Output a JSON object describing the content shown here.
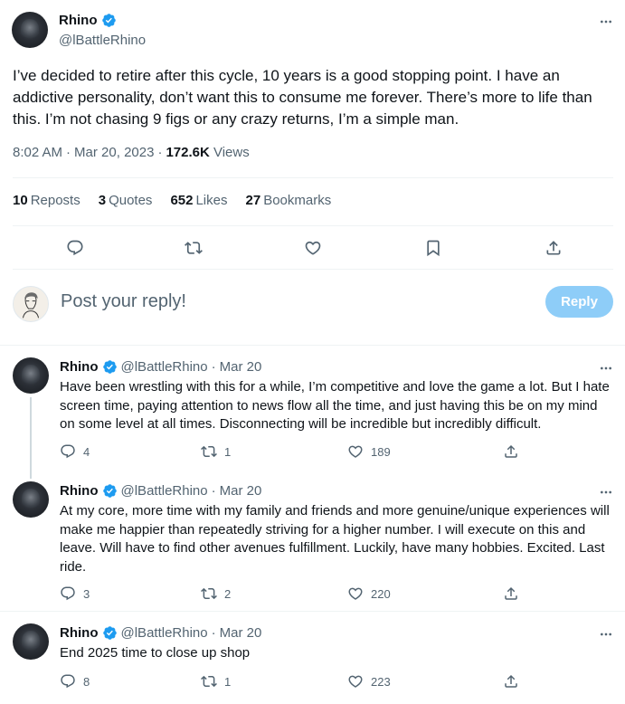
{
  "tweet": {
    "author_name": "Rhino",
    "author_handle": "@lBattleRhino",
    "text": "I’ve decided to retire after this cycle, 10 years is a good stopping point. I have an addictive personality, don’t want this to consume me forever. There’s more to life than this. I’m not chasing 9 figs or any crazy returns, I’m a simple man.",
    "time": "8:02 AM",
    "date": "Mar 20, 2023",
    "views_count": "172.6K",
    "views_label": "Views",
    "reposts_count": "10",
    "reposts_label": "Reposts",
    "quotes_count": "3",
    "quotes_label": "Quotes",
    "likes_count": "652",
    "likes_label": "Likes",
    "bookmarks_count": "27",
    "bookmarks_label": "Bookmarks"
  },
  "reply_composer": {
    "placeholder": "Post your reply!",
    "button_label": "Reply"
  },
  "replies": [
    {
      "author_name": "Rhino",
      "author_handle": "@lBattleRhino",
      "date": "Mar 20",
      "text": "Have been wrestling with this for a while, I’m competitive and love the game a lot. But I hate screen time, paying attention to news flow all the time, and just having this be on my mind on some level at all times. Disconnecting will be incredible but incredibly difficult.",
      "replies": "4",
      "reposts": "1",
      "likes": "189"
    },
    {
      "author_name": "Rhino",
      "author_handle": "@lBattleRhino",
      "date": "Mar 20",
      "text": "At my core, more time with my family and friends and more genuine/unique experiences will make me happier than repeatedly striving for a higher number. I will execute on this and leave. Will have to find other avenues fulfillment. Luckily, have many hobbies. Excited. Last ride.",
      "replies": "3",
      "reposts": "2",
      "likes": "220"
    },
    {
      "author_name": "Rhino",
      "author_handle": "@lBattleRhino",
      "date": "Mar 20",
      "text": "End 2025 time to close up shop",
      "replies": "8",
      "reposts": "1",
      "likes": "223"
    }
  ],
  "separators": {
    "dot": "·"
  },
  "icons": {
    "verified": "verified-badge-icon",
    "more": "more-horizontal-icon",
    "reply": "reply-icon",
    "repost": "repost-icon",
    "like": "like-icon",
    "bookmark": "bookmark-icon",
    "share": "share-icon"
  },
  "colors": {
    "accent": "#1d9bf0",
    "reply_button": "#8ecdf8",
    "secondary_text": "#536471"
  }
}
